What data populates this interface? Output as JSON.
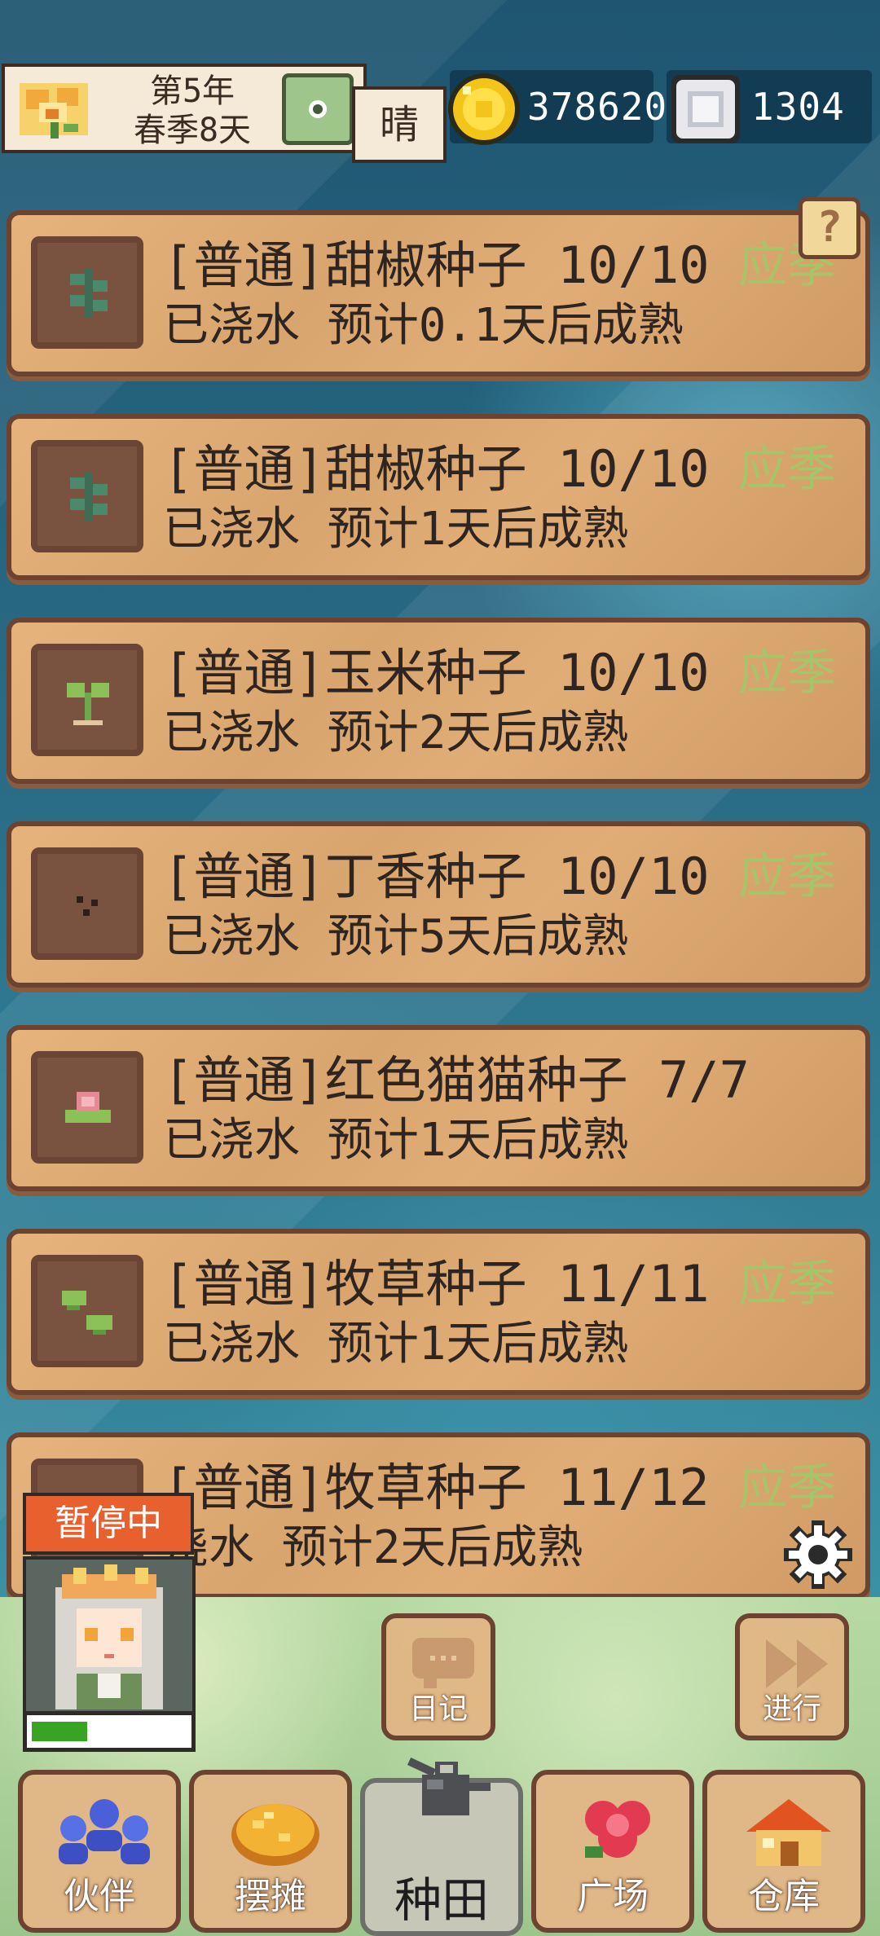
{
  "top_bar": {
    "year_label": "第5年",
    "season_day_label": "春季8天",
    "weather": "晴",
    "gold": "378620",
    "gems": "1304"
  },
  "help": {
    "label": "?"
  },
  "crops": [
    {
      "title": "[普通]甜椒种子 10/10",
      "status": "已浇水 预计0.1天后成熟",
      "badge": "应季",
      "plant_icon": "sprout-leaf-icon"
    },
    {
      "title": "[普通]甜椒种子 10/10",
      "status": "已浇水 预计1天后成熟",
      "badge": "应季",
      "plant_icon": "sprout-leaf-icon"
    },
    {
      "title": "[普通]玉米种子 10/10",
      "status": "已浇水 预计2天后成熟",
      "badge": "应季",
      "plant_icon": "seedling-icon"
    },
    {
      "title": "[普通]丁香种子 10/10",
      "status": "已浇水 预计5天后成熟",
      "badge": "应季",
      "plant_icon": "seed-icon"
    },
    {
      "title": "[普通]红色猫猫种子 7/7",
      "status": "已浇水 预计1天后成熟",
      "badge": "",
      "plant_icon": "pink-flower-icon"
    },
    {
      "title": "[普通]牧草种子 11/11",
      "status": "已浇水 预计1天后成熟",
      "badge": "应季",
      "plant_icon": "grass-icon"
    },
    {
      "title": "[普通]牧草种子 11/12",
      "status": "浇水 预计2天后成熟",
      "badge": "应季",
      "plant_icon": "grass-icon"
    }
  ],
  "companion_status": {
    "label": "暂停中",
    "energy_fraction": 0.36
  },
  "actions": {
    "diary": "日记",
    "proceed": "进行"
  },
  "nav": {
    "tabs": [
      {
        "label": "伙伴",
        "icon": "partners-icon"
      },
      {
        "label": "摆摊",
        "icon": "stall-icon"
      },
      {
        "label": "种田",
        "icon": "watering-can-icon"
      },
      {
        "label": "广场",
        "icon": "flower-icon"
      },
      {
        "label": "仓库",
        "icon": "warehouse-icon"
      }
    ],
    "active_tab": "种田"
  },
  "colors": {
    "season_badge": "#a8c46a",
    "card_border": "#6b4330",
    "pause_badge": "#e9602f",
    "energy": "#39a323"
  }
}
